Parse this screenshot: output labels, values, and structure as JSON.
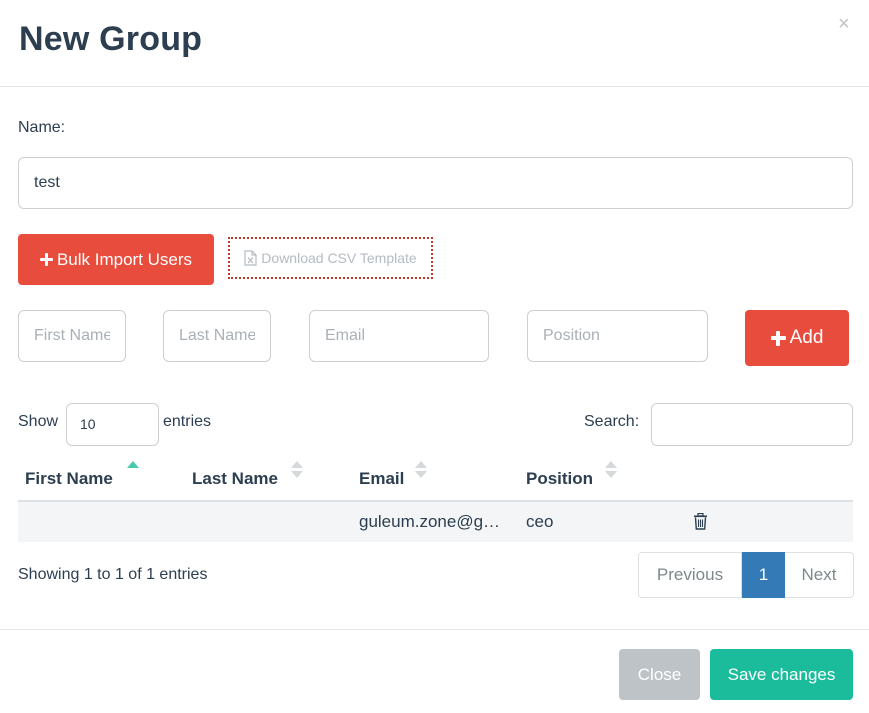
{
  "modal": {
    "title": "New Group",
    "close_glyph": "×"
  },
  "form": {
    "name_label": "Name:",
    "name_value": "test"
  },
  "bulk": {
    "import_label": "Bulk Import Users",
    "csv_label": "Download CSV Template"
  },
  "add_user": {
    "first_placeholder": "First Name",
    "last_placeholder": "Last Name",
    "email_placeholder": "Email",
    "position_placeholder": "Position",
    "add_label": "Add"
  },
  "table_controls": {
    "show_label": "Show",
    "entries_value": "10",
    "entries_label": "entries",
    "search_label": "Search:"
  },
  "table": {
    "columns": [
      "First Name",
      "Last Name",
      "Email",
      "Position"
    ],
    "sorted_column": "First Name",
    "rows": [
      {
        "first": "",
        "last": "",
        "email": "guleum.zone@g…",
        "position": "ceo"
      }
    ]
  },
  "pagination": {
    "info": "Showing 1 to 1 of 1 entries",
    "previous": "Previous",
    "current_page": "1",
    "next": "Next"
  },
  "footer": {
    "close_label": "Close",
    "save_label": "Save changes"
  },
  "colors": {
    "danger": "#e74c3c",
    "success": "#1abc9c",
    "primary": "#337ab7",
    "muted": "#bdc3c7",
    "text": "#2c3e50"
  },
  "icons": {
    "bulk_import": "plus-icon",
    "csv": "file-excel-icon",
    "add": "plus-icon",
    "row_action": "trash-icon"
  }
}
